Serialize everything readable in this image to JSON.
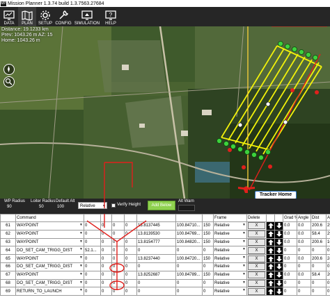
{
  "window": {
    "title": "Mission Planner 1.3.74 build 1.3.7563.27684",
    "app_icon_text": "MP"
  },
  "toolbar": {
    "items": [
      {
        "label": "DATA",
        "icon": "data-monitor-icon"
      },
      {
        "label": "PLAN",
        "icon": "plan-map-icon",
        "active": true
      },
      {
        "label": "SETUP",
        "icon": "setup-gear-icon"
      },
      {
        "label": "CONFIG",
        "icon": "config-wrench-icon"
      },
      {
        "label": "SIMULATION",
        "icon": "simulation-monitor-icon"
      },
      {
        "label": "HELP",
        "icon": "help-monitor-icon"
      }
    ]
  },
  "map": {
    "distance": "Distance: 19.1233 km",
    "prev": "Prev: 1043.26 m AZ: 15",
    "home": "Home: 1043.26 m",
    "tracker_home_label": "Tracker Home"
  },
  "config": {
    "wp_radius_label": "WP Radius",
    "wp_radius_value": "90",
    "loiter_radius_label": "Loiter Radius",
    "loiter_radius_value": "50",
    "default_alt_label": "Default Alt",
    "default_alt_value": "100",
    "altitude_frame": "Relative",
    "verify_height_label": "Verify Height",
    "add_below_label": "Add Below",
    "alt_warn_label": "Alt Warn"
  },
  "grid": {
    "headers": [
      "",
      "Command",
      "",
      "",
      "",
      "",
      "",
      "",
      "",
      "Frame",
      "Delete",
      "",
      "",
      "Grad %",
      "Angle",
      "Dist",
      "AZ"
    ],
    "rows": [
      {
        "num": "61",
        "command": "WAYPOINT",
        "p1": "0",
        "p2": "0",
        "p3": "0",
        "p4": "0",
        "lat": "13.8137445",
        "lon": "100.84710...",
        "alt": "150",
        "frame": "Relative",
        "grad": "0.0",
        "angle": "0.0",
        "dist": "200.6",
        "az": "252"
      },
      {
        "num": "62",
        "command": "WAYPOINT",
        "p1": "0",
        "p2": "0",
        "p3": "0",
        "p4": "0",
        "lat": "13.8139530",
        "lon": "100.84769...",
        "alt": "150",
        "frame": "Relative",
        "grad": "0.0",
        "angle": "0.0",
        "dist": "58.4",
        "az": "293"
      },
      {
        "num": "63",
        "command": "WAYPOINT",
        "p1": "0",
        "p2": "0",
        "p3": "0",
        "p4": "0",
        "lat": "13.8154777",
        "lon": "100.84820...",
        "alt": "150",
        "frame": "Relative",
        "grad": "0.0",
        "angle": "0.0",
        "dist": "200.6",
        "az": "16"
      },
      {
        "num": "64",
        "command": "DO_SET_CAM_TRIGG_DIST",
        "p1": "52.1...",
        "p2": "0",
        "p3": "0",
        "p4": "0",
        "lat": "0",
        "lon": "0",
        "alt": "0",
        "frame": "Relative",
        "grad": "0",
        "angle": "0",
        "dist": "0",
        "az": "0"
      },
      {
        "num": "65",
        "command": "WAYPOINT",
        "p1": "0",
        "p2": "0",
        "p3": "0",
        "p4": "0",
        "lat": "13.8237440",
        "lon": "100.84720...",
        "alt": "150",
        "frame": "Relative",
        "grad": "0.0",
        "angle": "0.0",
        "dist": "200.6",
        "az": "242"
      },
      {
        "num": "66",
        "command": "DO_SET_CAM_TRIGG_DIST",
        "p1": "0",
        "p2": "0",
        "p3": "0",
        "p4": "0",
        "lat": "0",
        "lon": "0",
        "alt": "0",
        "frame": "Relative",
        "grad": "0",
        "angle": "0",
        "dist": "0",
        "az": "0"
      },
      {
        "num": "67",
        "command": "WAYPOINT",
        "p1": "0",
        "p2": "0",
        "p3": "0",
        "p4": "0",
        "lat": "13.8252687",
        "lon": "100.84789...",
        "alt": "150",
        "frame": "Relative",
        "grad": "0.0",
        "angle": "0.0",
        "dist": "58.4",
        "az": "20"
      },
      {
        "num": "68",
        "command": "DO_SET_CAM_TRIGG_DIST",
        "p1": "0",
        "p2": "0",
        "p3": "0",
        "p4": "0",
        "lat": "0",
        "lon": "0",
        "alt": "0",
        "frame": "Relative",
        "grad": "0",
        "angle": "0",
        "dist": "0",
        "az": "0"
      },
      {
        "num": "69",
        "command": "RETURN_TO_LAUNCH",
        "p1": "0",
        "p2": "0",
        "p3": "0",
        "p4": "0",
        "lat": "0",
        "lon": "0",
        "alt": "0",
        "frame": "Relative",
        "grad": "0",
        "angle": "0",
        "dist": "0",
        "az": "0"
      }
    ],
    "delete_label": "X"
  },
  "colors": {
    "accent_green": "#8fd14f",
    "annotation_red": "#e0201c",
    "survey_yellow": "#f2f20a",
    "marker_green": "#3dd13d"
  }
}
